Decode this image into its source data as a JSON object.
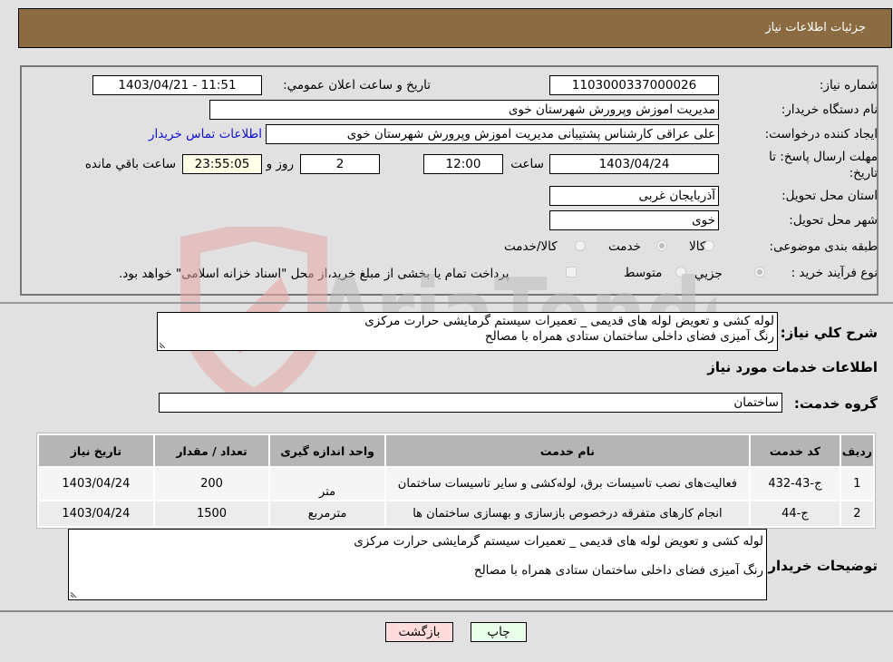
{
  "header": {
    "title": "جزئیات اطلاعات نیاز"
  },
  "form": {
    "need_number_label": "شماره نیاز:",
    "need_number": "1103000337000026",
    "announce_label": "تاریخ و ساعت اعلان عمومي:",
    "announce_value": "1403/04/21 - 11:51",
    "buyer_org_label": "نام دستگاه خریدار:",
    "buyer_org": "مدیریت اموزش وپرورش شهرستان خوی",
    "creator_label": "ایجاد کننده درخواست:",
    "creator": "علی عراقی کارشناس پشتیبانی مدیریت اموزش وپرورش شهرستان خوی",
    "contact_link": "اطلاعات تماس خریدار",
    "deadline_label": "مهلت ارسال پاسخ: تا تاریخ:",
    "deadline_date": "1403/04/24",
    "time_label": "ساعت",
    "deadline_time": "12:00",
    "days": "2",
    "days_label": "روز و",
    "remaining_time": "23:55:05",
    "remaining_label": "ساعت باقي مانده",
    "province_label": "استان محل تحویل:",
    "province": "آذربایجان غربی",
    "city_label": "شهر محل تحویل:",
    "city": "خوی",
    "category_label": "طبقه بندی موضوعی:",
    "category_options": [
      {
        "label": "کالا",
        "checked": false
      },
      {
        "label": "خدمت",
        "checked": true
      },
      {
        "label": "کالا/خدمت",
        "checked": false
      }
    ],
    "process_label": "نوع فرآیند خرید :",
    "process_options": [
      {
        "label": "جزيي",
        "checked": true
      },
      {
        "label": "متوسط",
        "checked": false
      }
    ],
    "treasury_note": "پرداخت تمام یا بخشی از مبلغ خرید،از محل \"اسناد خزانه اسلامی\" خواهد بود."
  },
  "summary": {
    "label": "شرح كلي نياز:",
    "line1": "لوله کشی و تعویض لوله های قدیمی _ تعمیرات سیستم گرمایشی حرارت مرکزی",
    "line2": "رنگ آمیزی فضای داخلی ساختمان ستادی همراه با مصالح"
  },
  "services": {
    "section_title": "اطلاعات خدمات مورد نیاز",
    "group_label": "گروه خدمت:",
    "group_value": "ساختمان",
    "columns": [
      "ردیف",
      "کد خدمت",
      "نام خدمت",
      "واحد اندازه گیری",
      "تعداد / مقدار",
      "تاریخ نیاز"
    ],
    "rows": [
      {
        "index": "1",
        "code": "ج-43-432",
        "name": "فعالیت‌های نصب تاسیسات برق، لوله‌کشی و سایر تاسیسات ساختمان",
        "unit": "متر",
        "qty": "200",
        "date": "1403/04/24"
      },
      {
        "index": "2",
        "code": "ج-44",
        "name": "انجام کارهای متفرقه درخصوص بازسازی و بهسازی ساختمان ها",
        "unit": "مترمربع",
        "qty": "1500",
        "date": "1403/04/24"
      }
    ]
  },
  "buyer_notes": {
    "label": "توضیحات خریدار:",
    "line1": "لوله کشی و تعویض لوله های قدیمی _ تعمیرات سیستم گرمایشی حرارت مرکزی",
    "line2": "رنگ آمیزی فضای داخلی ساختمان ستادی همراه با مصالح"
  },
  "buttons": {
    "print": "چاپ",
    "back": "بازگشت"
  },
  "colors": {
    "header_bg": "#8b6c42",
    "print_bg": "#eaffea",
    "back_bg": "#ffdcdc"
  },
  "watermark": {
    "text": "AriaTender.neT"
  }
}
